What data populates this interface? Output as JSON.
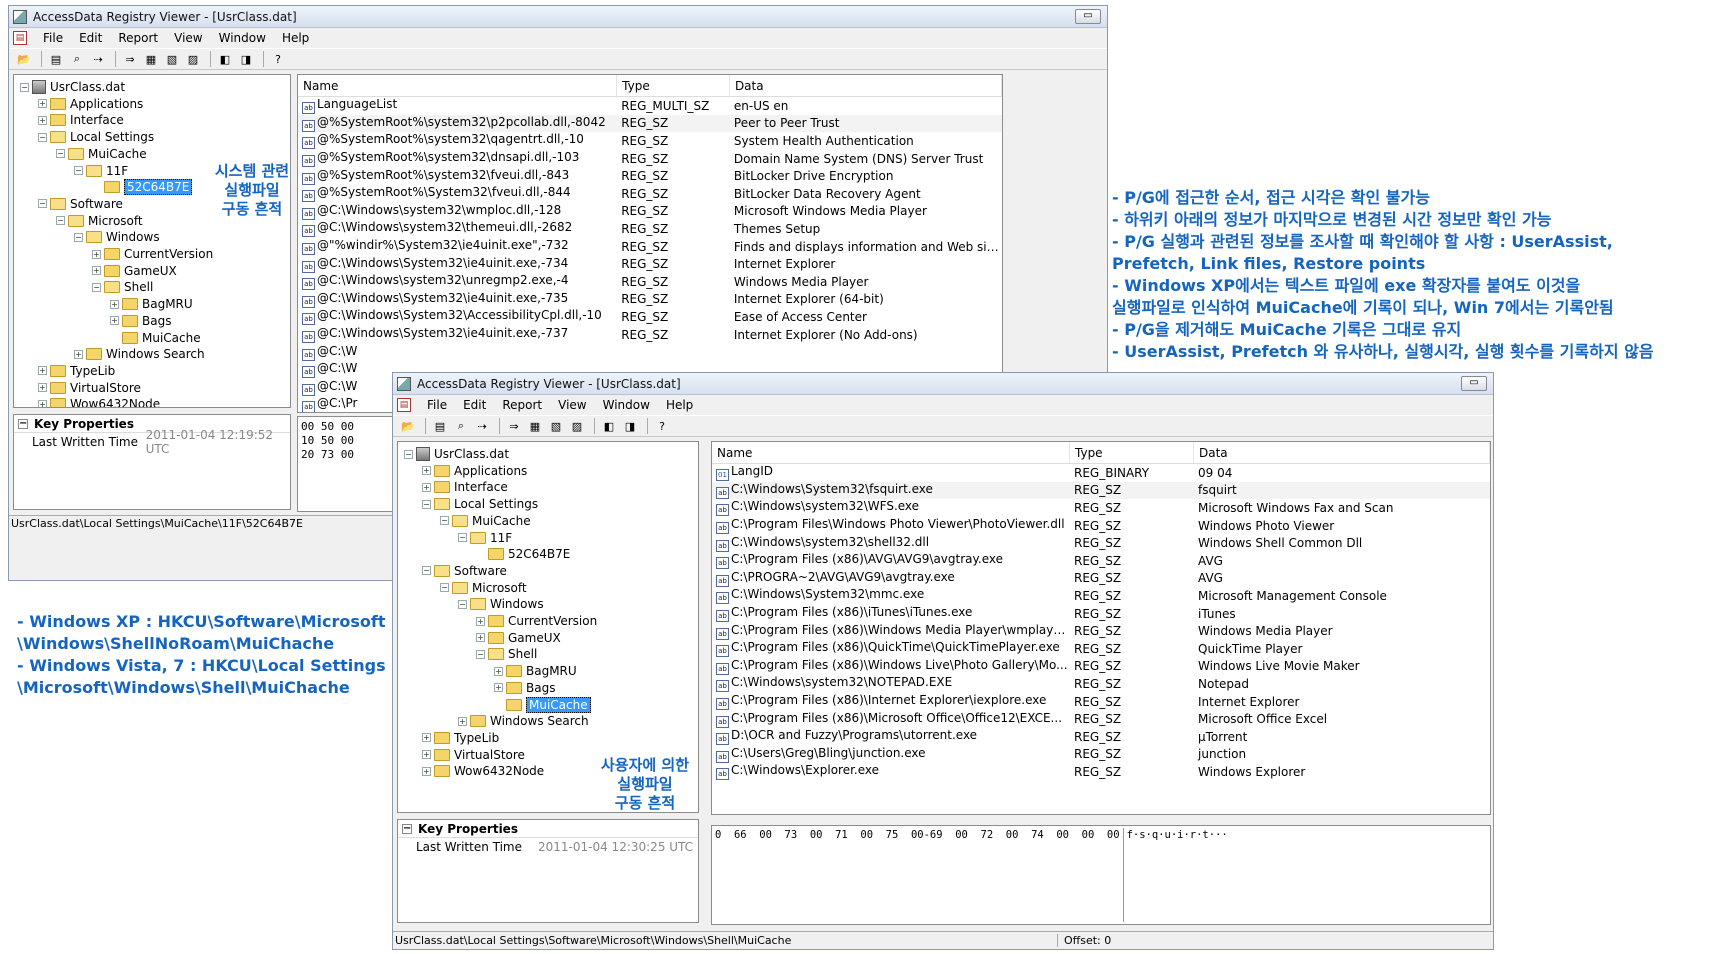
{
  "back": {
    "title": "AccessData Registry Viewer - [UsrClass.dat]",
    "tree": [
      {
        "label": "UsrClass.dat",
        "lvl": 0,
        "kind": "file",
        "pm": "-"
      },
      {
        "label": "Applications",
        "lvl": 1,
        "pm": "+"
      },
      {
        "label": "Interface",
        "lvl": 1,
        "pm": "+"
      },
      {
        "label": "Local Settings",
        "lvl": 1,
        "pm": "-"
      },
      {
        "label": "MuiCache",
        "lvl": 2,
        "pm": "-"
      },
      {
        "label": "11F",
        "lvl": 3,
        "pm": "-"
      },
      {
        "label": "52C64B7E",
        "lvl": 4,
        "pm": "",
        "sel": true
      },
      {
        "label": "Software",
        "lvl": 1,
        "pm": "-"
      },
      {
        "label": "Microsoft",
        "lvl": 2,
        "pm": "-"
      },
      {
        "label": "Windows",
        "lvl": 3,
        "pm": "-"
      },
      {
        "label": "CurrentVersion",
        "lvl": 4,
        "pm": "+"
      },
      {
        "label": "GameUX",
        "lvl": 4,
        "pm": "+"
      },
      {
        "label": "Shell",
        "lvl": 4,
        "pm": "-"
      },
      {
        "label": "BagMRU",
        "lvl": 5,
        "pm": "+"
      },
      {
        "label": "Bags",
        "lvl": 5,
        "pm": "+"
      },
      {
        "label": "MuiCache",
        "lvl": 5,
        "pm": ""
      },
      {
        "label": "Windows Search",
        "lvl": 3,
        "pm": "+"
      },
      {
        "label": "TypeLib",
        "lvl": 1,
        "pm": "+"
      },
      {
        "label": "VirtualStore",
        "lvl": 1,
        "pm": "+"
      },
      {
        "label": "Wow6432Node",
        "lvl": 1,
        "pm": "+"
      }
    ],
    "props_header": "Key Properties",
    "props_key": "Last Written Time",
    "props_val": "2011-01-04 12:19:52 UTC",
    "status": "UsrClass.dat\\Local Settings\\MuiCache\\11F\\52C64B7E",
    "columns": [
      "Name",
      "Type",
      "Data"
    ],
    "rows": [
      {
        "icon": "ab",
        "name": "LanguageList",
        "type": "REG_MULTI_SZ",
        "data": "en-US en"
      },
      {
        "icon": "ab",
        "name": "@%SystemRoot%\\system32\\p2pcollab.dll,-8042",
        "type": "REG_SZ",
        "data": "Peer to Peer Trust"
      },
      {
        "icon": "ab",
        "name": "@%SystemRoot%\\system32\\qagentrt.dll,-10",
        "type": "REG_SZ",
        "data": "System Health Authentication"
      },
      {
        "icon": "ab",
        "name": "@%SystemRoot%\\system32\\dnsapi.dll,-103",
        "type": "REG_SZ",
        "data": "Domain Name System (DNS) Server Trust"
      },
      {
        "icon": "ab",
        "name": "@%SystemRoot%\\system32\\fveui.dll,-843",
        "type": "REG_SZ",
        "data": "BitLocker Drive Encryption"
      },
      {
        "icon": "ab",
        "name": "@%SystemRoot%\\System32\\fveui.dll,-844",
        "type": "REG_SZ",
        "data": "BitLocker Data Recovery Agent"
      },
      {
        "icon": "ab",
        "name": "@C:\\Windows\\system32\\wmploc.dll,-128",
        "type": "REG_SZ",
        "data": "Microsoft Windows Media Player"
      },
      {
        "icon": "ab",
        "name": "@C:\\Windows\\system32\\themeui.dll,-2682",
        "type": "REG_SZ",
        "data": "Themes Setup"
      },
      {
        "icon": "ab",
        "name": "@\"%windir%\\System32\\ie4uinit.exe\",-732",
        "type": "REG_SZ",
        "data": "Finds and displays information and Web sites on th..."
      },
      {
        "icon": "ab",
        "name": "@C:\\Windows\\System32\\ie4uinit.exe,-734",
        "type": "REG_SZ",
        "data": "Internet Explorer"
      },
      {
        "icon": "ab",
        "name": "@C:\\Windows\\system32\\unregmp2.exe,-4",
        "type": "REG_SZ",
        "data": "Windows Media Player"
      },
      {
        "icon": "ab",
        "name": "@C:\\Windows\\System32\\ie4uinit.exe,-735",
        "type": "REG_SZ",
        "data": "Internet Explorer (64-bit)"
      },
      {
        "icon": "ab",
        "name": "@C:\\Windows\\System32\\AccessibilityCpl.dll,-10",
        "type": "REG_SZ",
        "data": "Ease of Access Center"
      },
      {
        "icon": "ab",
        "name": "@C:\\Windows\\System32\\ie4uinit.exe,-737",
        "type": "REG_SZ",
        "data": "Internet Explorer (No Add-ons)"
      },
      {
        "icon": "ab",
        "name": "@C:\\W",
        "type": "",
        "data": ""
      },
      {
        "icon": "ab",
        "name": "@C:\\W",
        "type": "",
        "data": ""
      },
      {
        "icon": "ab",
        "name": "@C:\\W",
        "type": "",
        "data": ""
      },
      {
        "icon": "ab",
        "name": "@C:\\Pr",
        "type": "",
        "data": ""
      }
    ],
    "hex": [
      "00  50  00",
      "10  50  00",
      "20  73  00"
    ]
  },
  "front": {
    "title": "AccessData Registry Viewer - [UsrClass.dat]",
    "tree": [
      {
        "label": "UsrClass.dat",
        "lvl": 0,
        "kind": "file",
        "pm": "-"
      },
      {
        "label": "Applications",
        "lvl": 1,
        "pm": "+"
      },
      {
        "label": "Interface",
        "lvl": 1,
        "pm": "+"
      },
      {
        "label": "Local Settings",
        "lvl": 1,
        "pm": "-"
      },
      {
        "label": "MuiCache",
        "lvl": 2,
        "pm": "-"
      },
      {
        "label": "11F",
        "lvl": 3,
        "pm": "-"
      },
      {
        "label": "52C64B7E",
        "lvl": 4,
        "pm": ""
      },
      {
        "label": "Software",
        "lvl": 1,
        "pm": "-"
      },
      {
        "label": "Microsoft",
        "lvl": 2,
        "pm": "-"
      },
      {
        "label": "Windows",
        "lvl": 3,
        "pm": "-"
      },
      {
        "label": "CurrentVersion",
        "lvl": 4,
        "pm": "+"
      },
      {
        "label": "GameUX",
        "lvl": 4,
        "pm": "+"
      },
      {
        "label": "Shell",
        "lvl": 4,
        "pm": "-"
      },
      {
        "label": "BagMRU",
        "lvl": 5,
        "pm": "+"
      },
      {
        "label": "Bags",
        "lvl": 5,
        "pm": "+"
      },
      {
        "label": "MuiCache",
        "lvl": 5,
        "pm": "",
        "sel": true
      },
      {
        "label": "Windows Search",
        "lvl": 3,
        "pm": "+"
      },
      {
        "label": "TypeLib",
        "lvl": 1,
        "pm": "+"
      },
      {
        "label": "VirtualStore",
        "lvl": 1,
        "pm": "+"
      },
      {
        "label": "Wow6432Node",
        "lvl": 1,
        "pm": "+"
      }
    ],
    "props_header": "Key Properties",
    "props_key": "Last Written Time",
    "props_val": "2011-01-04 12:30:25 UTC",
    "status": "UsrClass.dat\\Local Settings\\Software\\Microsoft\\Windows\\Shell\\MuiCache",
    "status_offset": "Offset: 0",
    "columns": [
      "Name",
      "Type",
      "Data"
    ],
    "rows": [
      {
        "icon": "bin",
        "name": "LangID",
        "type": "REG_BINARY",
        "data": "09 04"
      },
      {
        "icon": "ab",
        "name": "C:\\Windows\\System32\\fsquirt.exe",
        "type": "REG_SZ",
        "data": "fsquirt"
      },
      {
        "icon": "ab",
        "name": "C:\\Windows\\system32\\WFS.exe",
        "type": "REG_SZ",
        "data": "Microsoft  Windows Fax and Scan"
      },
      {
        "icon": "ab",
        "name": "C:\\Program Files\\Windows Photo Viewer\\PhotoViewer.dll",
        "type": "REG_SZ",
        "data": "Windows Photo Viewer"
      },
      {
        "icon": "ab",
        "name": "C:\\Windows\\system32\\shell32.dll",
        "type": "REG_SZ",
        "data": "Windows Shell Common Dll"
      },
      {
        "icon": "ab",
        "name": "C:\\Program Files (x86)\\AVG\\AVG9\\avgtray.exe",
        "type": "REG_SZ",
        "data": "AVG"
      },
      {
        "icon": "ab",
        "name": "C:\\PROGRA~2\\AVG\\AVG9\\avgtray.exe",
        "type": "REG_SZ",
        "data": "AVG"
      },
      {
        "icon": "ab",
        "name": "C:\\Windows\\System32\\mmc.exe",
        "type": "REG_SZ",
        "data": "Microsoft Management Console"
      },
      {
        "icon": "ab",
        "name": "C:\\Program Files (x86)\\iTunes\\iTunes.exe",
        "type": "REG_SZ",
        "data": "iTunes"
      },
      {
        "icon": "ab",
        "name": "C:\\Program Files (x86)\\Windows Media Player\\wmplaye...",
        "type": "REG_SZ",
        "data": "Windows Media Player"
      },
      {
        "icon": "ab",
        "name": "C:\\Program Files (x86)\\QuickTime\\QuickTimePlayer.exe",
        "type": "REG_SZ",
        "data": "QuickTime Player"
      },
      {
        "icon": "ab",
        "name": "C:\\Program Files (x86)\\Windows Live\\Photo Gallery\\Mo...",
        "type": "REG_SZ",
        "data": "Windows Live Movie Maker"
      },
      {
        "icon": "ab",
        "name": "C:\\Windows\\system32\\NOTEPAD.EXE",
        "type": "REG_SZ",
        "data": "Notepad"
      },
      {
        "icon": "ab",
        "name": "C:\\Program Files (x86)\\Internet Explorer\\iexplore.exe",
        "type": "REG_SZ",
        "data": "Internet Explorer"
      },
      {
        "icon": "ab",
        "name": "C:\\Program Files (x86)\\Microsoft Office\\Office12\\EXCE...",
        "type": "REG_SZ",
        "data": "Microsoft Office Excel"
      },
      {
        "icon": "ab",
        "name": "D:\\OCR and Fuzzy\\Programs\\utorrent.exe",
        "type": "REG_SZ",
        "data": "µTorrent"
      },
      {
        "icon": "ab",
        "name": "C:\\Users\\Greg\\Bling\\junction.exe",
        "type": "REG_SZ",
        "data": "junction"
      },
      {
        "icon": "ab",
        "name": "C:\\Windows\\Explorer.exe",
        "type": "REG_SZ",
        "data": "Windows Explorer"
      }
    ],
    "hex_line": "0  66  00  73  00  71  00  75  00-69  00  72  00  74  00  00  00",
    "hex_ascii": "f·s·q·u·i·r·t···"
  },
  "menu": [
    "File",
    "Edit",
    "Report",
    "View",
    "Window",
    "Help"
  ],
  "annotations": {
    "label_system": [
      "시스템 관련",
      "실행파일",
      "구동 흔적"
    ],
    "label_user": [
      "사용자에 의한",
      "실행파일",
      "구동 흔적"
    ],
    "left_notes": [
      "-    Windows XP : HKCU\\Software\\Microsoft",
      "\\Windows\\ShellNoRoam\\MuiChache",
      "-    Windows Vista, 7 : HKCU\\Local Settings",
      "\\Microsoft\\Windows\\Shell\\MuiChache"
    ],
    "right_notes": [
      "-    P/G에 접근한 순서, 접근 시각은 확인 불가능",
      "-    하위키 아래의 정보가 마지막으로 변경된 시간 정보만 확인 가능",
      "-    P/G 실행과 관련된 정보를 조사할 때 확인해야 할 사항 : UserAssist,",
      "Prefetch, Link files, Restore points",
      "-    Windows XP에서는 텍스트 파일에 exe 확장자를 붙여도 이것을",
      "실행파일로 인식하여 MuiCache에 기록이 되나, Win 7에서는 기록안됨",
      "-    P/G을 제거해도 MuiCache 기록은 그대로 유지",
      "-    UserAssist, Prefetch 와 유사하나, 실행시각, 실행 횟수를 기록하지 않음"
    ]
  }
}
